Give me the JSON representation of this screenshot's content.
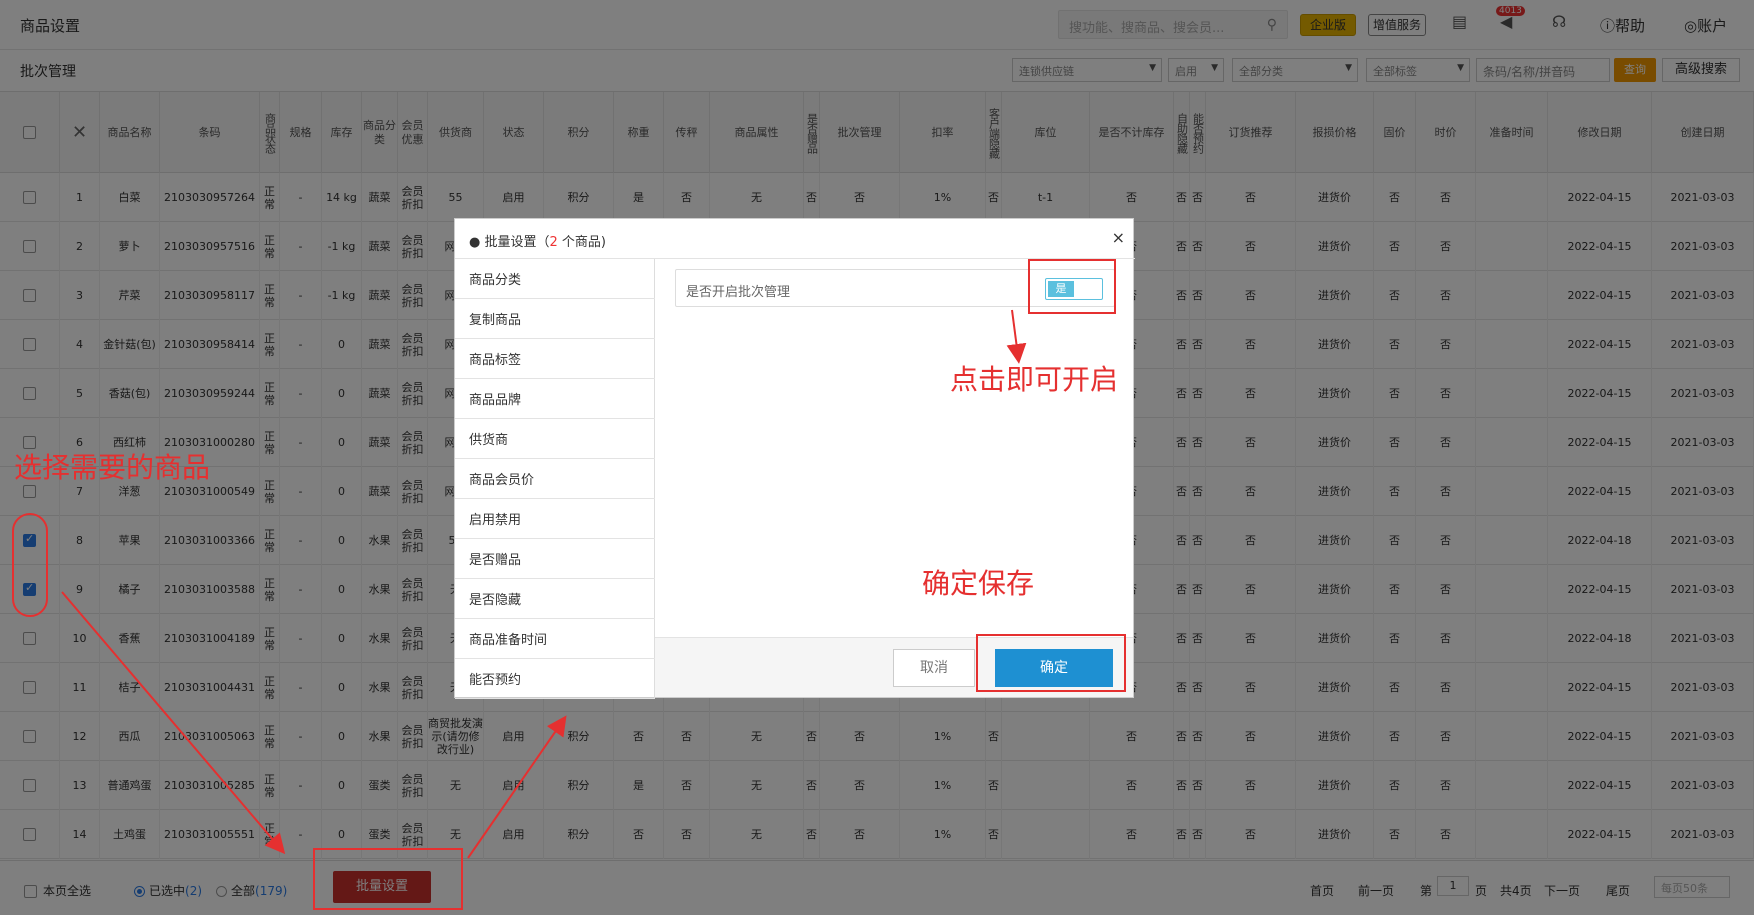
{
  "app": {
    "title": "商品设置"
  },
  "topbar": {
    "search_placeholder": "搜功能、搜商品、搜会员...",
    "enterprise": "企业版",
    "vas": "增值服务",
    "badge": "4013",
    "help": "帮助",
    "account": "账户"
  },
  "subbar": {
    "title": "批次管理",
    "filters": [
      "连锁供应链",
      "启用",
      "全部分类",
      "全部标签"
    ],
    "barcode_placeholder": "条码/名称/拼音码",
    "query": "查询",
    "advanced": "高级搜索"
  },
  "table": {
    "headers": [
      "商品名称",
      "条码",
      "商品状态",
      "规格",
      "库存",
      "商品分类",
      "会员优惠",
      "供货商",
      "状态",
      "积分",
      "称重",
      "传秤",
      "商品属性",
      "是否赠品",
      "批次管理",
      "扣率",
      "客户端隐藏",
      "库位",
      "是否不计库存",
      "自助隐藏",
      "能否预约",
      "订货推荐",
      "报损价格",
      "固价",
      "时价",
      "准备时间",
      "修改日期",
      "创建日期"
    ],
    "rows": [
      {
        "no": "1",
        "name": "白菜",
        "barcode": "2103030957264",
        "status": "正常",
        "spec": "-",
        "stock": "14 kg",
        "cat": "蔬菜",
        "member": "会员折扣",
        "supplier": "55",
        "state": "启用",
        "points": "积分",
        "weigh": "是",
        "scale": "否",
        "attr": "无",
        "gift": "否",
        "batch": "否",
        "rate": "1%",
        "hide": "否",
        "loc": "t-1",
        "nostock": "否",
        "selfhide": "否",
        "reserve": "否",
        "recommend": "否",
        "loss": "进货价",
        "fixed": "否",
        "timep": "否",
        "mod": "2022-04-15",
        "created": "2021-03-03",
        "checked": false
      },
      {
        "no": "2",
        "name": "萝卜",
        "barcode": "2103030957516",
        "status": "正常",
        "spec": "-",
        "stock": "-1 kg",
        "cat": "蔬菜",
        "member": "会员折扣",
        "supplier": "网络",
        "state": "",
        "points": "",
        "weigh": "",
        "scale": "",
        "attr": "",
        "gift": "",
        "batch": "",
        "rate": "",
        "hide": "",
        "loc": "",
        "nostock": "否",
        "selfhide": "否",
        "reserve": "否",
        "recommend": "否",
        "loss": "进货价",
        "fixed": "否",
        "timep": "否",
        "mod": "2022-04-15",
        "created": "2021-03-03",
        "checked": false
      },
      {
        "no": "3",
        "name": "芹菜",
        "barcode": "2103030958117",
        "status": "正常",
        "spec": "-",
        "stock": "-1 kg",
        "cat": "蔬菜",
        "member": "会员折扣",
        "supplier": "网络",
        "state": "",
        "points": "",
        "weigh": "",
        "scale": "",
        "attr": "",
        "gift": "",
        "batch": "",
        "rate": "",
        "hide": "",
        "loc": "",
        "nostock": "否",
        "selfhide": "否",
        "reserve": "否",
        "recommend": "否",
        "loss": "进货价",
        "fixed": "否",
        "timep": "否",
        "mod": "2022-04-15",
        "created": "2021-03-03",
        "checked": false
      },
      {
        "no": "4",
        "name": "金针菇(包)",
        "barcode": "2103030958414",
        "status": "正常",
        "spec": "-",
        "stock": "0",
        "cat": "蔬菜",
        "member": "会员折扣",
        "supplier": "网络",
        "state": "",
        "points": "",
        "weigh": "",
        "scale": "",
        "attr": "",
        "gift": "",
        "batch": "",
        "rate": "",
        "hide": "",
        "loc": "",
        "nostock": "否",
        "selfhide": "否",
        "reserve": "否",
        "recommend": "否",
        "loss": "进货价",
        "fixed": "否",
        "timep": "否",
        "mod": "2022-04-15",
        "created": "2021-03-03",
        "checked": false
      },
      {
        "no": "5",
        "name": "香菇(包)",
        "barcode": "2103030959244",
        "status": "正常",
        "spec": "-",
        "stock": "0",
        "cat": "蔬菜",
        "member": "会员折扣",
        "supplier": "网络",
        "state": "",
        "points": "",
        "weigh": "",
        "scale": "",
        "attr": "",
        "gift": "",
        "batch": "",
        "rate": "",
        "hide": "",
        "loc": "",
        "nostock": "否",
        "selfhide": "否",
        "reserve": "否",
        "recommend": "否",
        "loss": "进货价",
        "fixed": "否",
        "timep": "否",
        "mod": "2022-04-15",
        "created": "2021-03-03",
        "checked": false
      },
      {
        "no": "6",
        "name": "西红柿",
        "barcode": "2103031000280",
        "status": "正常",
        "spec": "-",
        "stock": "0",
        "cat": "蔬菜",
        "member": "会员折扣",
        "supplier": "网络",
        "state": "",
        "points": "",
        "weigh": "",
        "scale": "",
        "attr": "",
        "gift": "",
        "batch": "",
        "rate": "",
        "hide": "",
        "loc": "",
        "nostock": "否",
        "selfhide": "否",
        "reserve": "否",
        "recommend": "否",
        "loss": "进货价",
        "fixed": "否",
        "timep": "否",
        "mod": "2022-04-15",
        "created": "2021-03-03",
        "checked": false
      },
      {
        "no": "7",
        "name": "洋葱",
        "barcode": "2103031000549",
        "status": "正常",
        "spec": "-",
        "stock": "0",
        "cat": "蔬菜",
        "member": "会员折扣",
        "supplier": "网络",
        "state": "",
        "points": "",
        "weigh": "",
        "scale": "",
        "attr": "",
        "gift": "",
        "batch": "",
        "rate": "",
        "hide": "",
        "loc": "",
        "nostock": "否",
        "selfhide": "否",
        "reserve": "否",
        "recommend": "否",
        "loss": "进货价",
        "fixed": "否",
        "timep": "否",
        "mod": "2022-04-15",
        "created": "2021-03-03",
        "checked": false
      },
      {
        "no": "8",
        "name": "苹果",
        "barcode": "2103031003366",
        "status": "正常",
        "spec": "-",
        "stock": "0",
        "cat": "水果",
        "member": "会员折扣",
        "supplier": "55",
        "state": "",
        "points": "",
        "weigh": "",
        "scale": "",
        "attr": "",
        "gift": "",
        "batch": "",
        "rate": "",
        "hide": "",
        "loc": "",
        "nostock": "否",
        "selfhide": "否",
        "reserve": "否",
        "recommend": "否",
        "loss": "进货价",
        "fixed": "否",
        "timep": "否",
        "mod": "2022-04-18",
        "created": "2021-03-03",
        "checked": true
      },
      {
        "no": "9",
        "name": "橘子",
        "barcode": "2103031003588",
        "status": "正常",
        "spec": "-",
        "stock": "0",
        "cat": "水果",
        "member": "会员折扣",
        "supplier": "无",
        "state": "",
        "points": "",
        "weigh": "",
        "scale": "",
        "attr": "",
        "gift": "",
        "batch": "",
        "rate": "",
        "hide": "",
        "loc": "",
        "nostock": "否",
        "selfhide": "否",
        "reserve": "否",
        "recommend": "否",
        "loss": "进货价",
        "fixed": "否",
        "timep": "否",
        "mod": "2022-04-15",
        "created": "2021-03-03",
        "checked": true
      },
      {
        "no": "10",
        "name": "香蕉",
        "barcode": "2103031004189",
        "status": "正常",
        "spec": "-",
        "stock": "0",
        "cat": "水果",
        "member": "会员折扣",
        "supplier": "无",
        "state": "",
        "points": "",
        "weigh": "",
        "scale": "",
        "attr": "",
        "gift": "",
        "batch": "",
        "rate": "",
        "hide": "",
        "loc": "",
        "nostock": "否",
        "selfhide": "否",
        "reserve": "否",
        "recommend": "否",
        "loss": "进货价",
        "fixed": "否",
        "timep": "否",
        "mod": "2022-04-18",
        "created": "2021-03-03",
        "checked": false
      },
      {
        "no": "11",
        "name": "桔子",
        "barcode": "2103031004431",
        "status": "正常",
        "spec": "-",
        "stock": "0",
        "cat": "水果",
        "member": "会员折扣",
        "supplier": "无",
        "state": "",
        "points": "",
        "weigh": "",
        "scale": "",
        "attr": "",
        "gift": "",
        "batch": "",
        "rate": "",
        "hide": "",
        "loc": "",
        "nostock": "否",
        "selfhide": "否",
        "reserve": "否",
        "recommend": "否",
        "loss": "进货价",
        "fixed": "否",
        "timep": "否",
        "mod": "2022-04-15",
        "created": "2021-03-03",
        "checked": false
      },
      {
        "no": "12",
        "name": "西瓜",
        "barcode": "2103031005063",
        "status": "正常",
        "spec": "-",
        "stock": "0",
        "cat": "水果",
        "member": "会员折扣",
        "supplier": "商贸批发演示(请勿修改行业)",
        "state": "启用",
        "points": "积分",
        "weigh": "否",
        "scale": "否",
        "attr": "无",
        "gift": "否",
        "batch": "否",
        "rate": "1%",
        "hide": "否",
        "loc": "",
        "nostock": "否",
        "selfhide": "否",
        "reserve": "否",
        "recommend": "否",
        "loss": "进货价",
        "fixed": "否",
        "timep": "否",
        "mod": "2022-04-15",
        "created": "2021-03-03",
        "checked": false
      },
      {
        "no": "13",
        "name": "普通鸡蛋",
        "barcode": "2103031005285",
        "status": "正常",
        "spec": "-",
        "stock": "0",
        "cat": "蛋类",
        "member": "会员折扣",
        "supplier": "无",
        "state": "启用",
        "points": "积分",
        "weigh": "是",
        "scale": "否",
        "attr": "无",
        "gift": "否",
        "batch": "否",
        "rate": "1%",
        "hide": "否",
        "loc": "",
        "nostock": "否",
        "selfhide": "否",
        "reserve": "否",
        "recommend": "否",
        "loss": "进货价",
        "fixed": "否",
        "timep": "否",
        "mod": "2022-04-15",
        "created": "2021-03-03",
        "checked": false
      },
      {
        "no": "14",
        "name": "土鸡蛋",
        "barcode": "2103031005551",
        "status": "正常",
        "spec": "-",
        "stock": "0",
        "cat": "蛋类",
        "member": "会员折扣",
        "supplier": "无",
        "state": "启用",
        "points": "积分",
        "weigh": "否",
        "scale": "否",
        "attr": "无",
        "gift": "否",
        "batch": "否",
        "rate": "1%",
        "hide": "否",
        "loc": "",
        "nostock": "否",
        "selfhide": "否",
        "reserve": "否",
        "recommend": "否",
        "loss": "进货价",
        "fixed": "否",
        "timep": "否",
        "mod": "2022-04-15",
        "created": "2021-03-03",
        "checked": false
      }
    ]
  },
  "modal": {
    "title_prefix": "● 批量设置（",
    "count": "2",
    "title_suffix": " 个商品)",
    "close": "×",
    "menu": [
      "商品分类",
      "复制商品",
      "商品标签",
      "商品品牌",
      "供货商",
      "商品会员价",
      "启用禁用",
      "是否赠品",
      "是否隐藏",
      "商品准备时间",
      "能否预约"
    ],
    "switch_label": "是否开启批次管理",
    "switch_on": "是",
    "cancel": "取消",
    "confirm": "确定"
  },
  "footer": {
    "select_page": "本页全选",
    "selected_label": "已选中",
    "selected_count": "(2)",
    "all_label": "全部",
    "all_count": "(179)",
    "batch": "批量设置",
    "first": "首页",
    "prev": "前一页",
    "page_prefix": "第",
    "page": "1",
    "page_suffix": "页",
    "total": "共4页",
    "next": "下一页",
    "last": "尾页",
    "per_page": "每页50条"
  },
  "annotations": {
    "select": "选择需要的商品",
    "click_open": "点击即可开启",
    "save": "确定保存"
  },
  "colors": {
    "accent": "#1e90d2",
    "annotation": "#e53030",
    "batch_btn": "#c9302c",
    "query": "#f39800"
  }
}
